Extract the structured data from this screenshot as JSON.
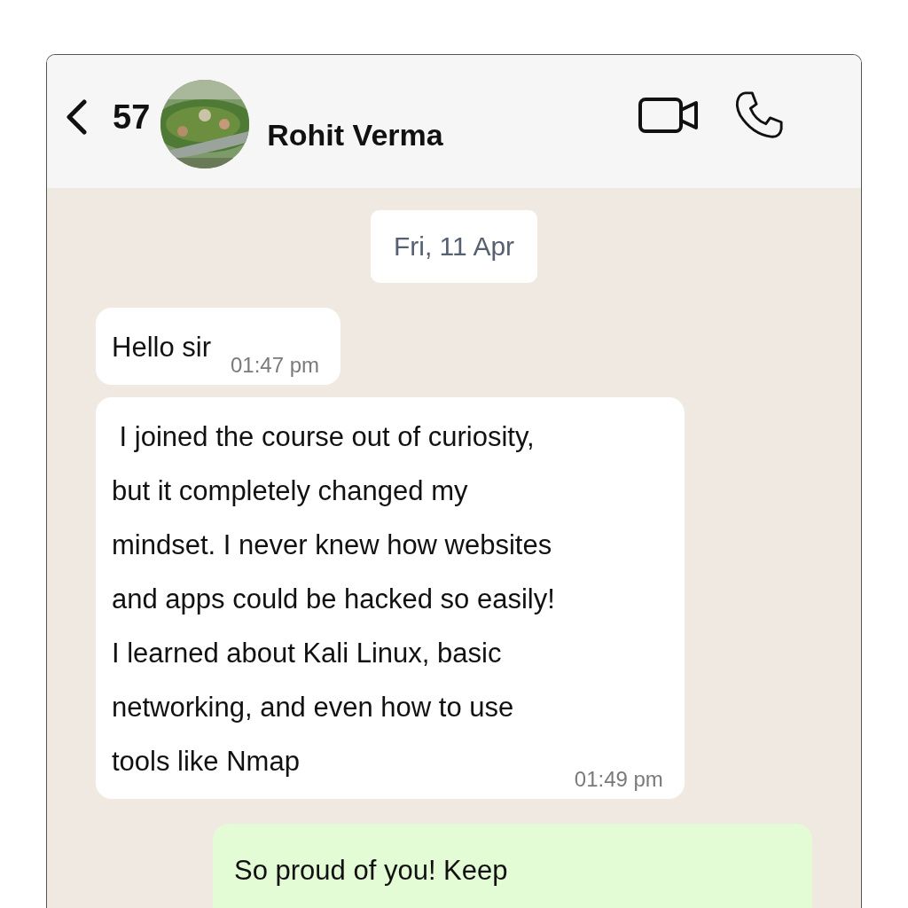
{
  "header": {
    "back_count": "57",
    "contact_name": "Rohit Verma"
  },
  "date_chip": "Fri, 11 Apr",
  "messages": [
    {
      "kind": "incoming",
      "text": "Hello sir",
      "time": "01:47 pm"
    },
    {
      "kind": "incoming",
      "text": " I joined the course out of curiosity,\nbut it completely changed my\nmindset. I never knew how websites\nand apps could be hacked so easily!\nI learned about Kali Linux, basic\nnetworking, and even how to use\ntools like Nmap",
      "time": "01:49 pm"
    },
    {
      "kind": "outgoing",
      "text": "So proud of you! Keep"
    }
  ]
}
